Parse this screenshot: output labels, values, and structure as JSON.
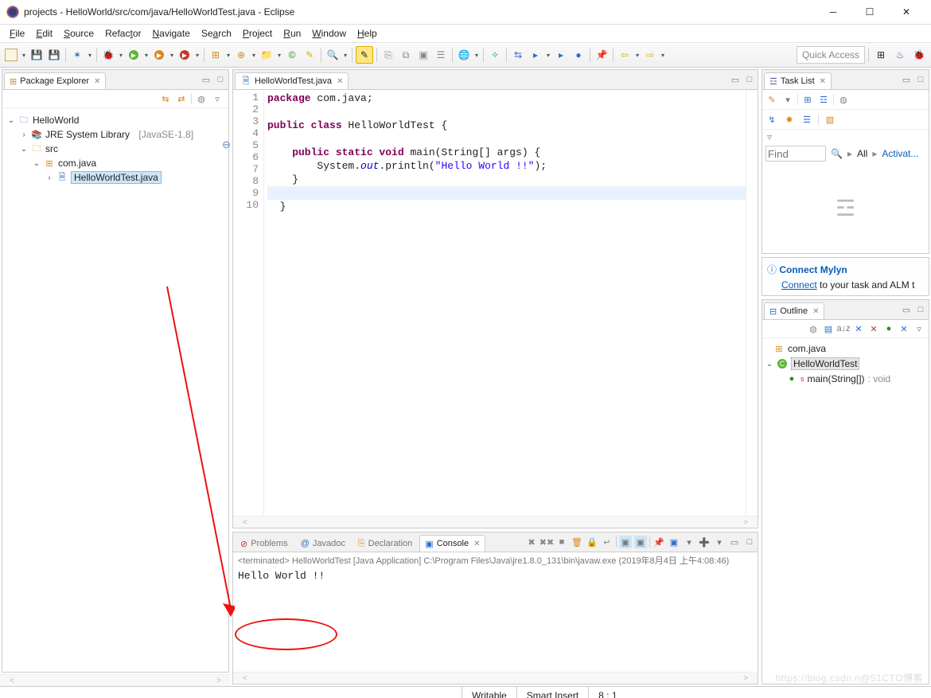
{
  "window": {
    "title": "projects - HelloWorld/src/com/java/HelloWorldTest.java - Eclipse"
  },
  "menu": [
    "File",
    "Edit",
    "Source",
    "Refactor",
    "Navigate",
    "Search",
    "Project",
    "Run",
    "Window",
    "Help"
  ],
  "quick_access_placeholder": "Quick Access",
  "package_explorer": {
    "title": "Package Explorer",
    "project": "HelloWorld",
    "jre": "JRE System Library",
    "jre_suffix": "[JavaSE-1.8]",
    "src": "src",
    "pkg": "com.java",
    "file": "HelloWorldTest.java"
  },
  "editor": {
    "tab": "HelloWorldTest.java",
    "lines": [
      "1",
      "2",
      "3",
      "4",
      "5",
      "6",
      "7",
      "8",
      "9",
      "10"
    ],
    "code": {
      "l1_pre": "package ",
      "l1_pkg": "com.java;",
      "l3_a": "public class ",
      "l3_b": "HelloWorldTest {",
      "l5_a": "    public static void ",
      "l5_b": "main(String[] args) {",
      "l6_a": "        System.",
      "l6_out": "out",
      "l6_b": ".println(",
      "l6_str": "\"Hello World !!\"",
      "l6_c": ");",
      "l7": "    }",
      "l9": "  }"
    }
  },
  "bottom": {
    "tabs": {
      "problems": "Problems",
      "javadoc": "Javadoc",
      "declaration": "Declaration",
      "console": "Console"
    },
    "console_head_a": "<terminated>",
    "console_head_b": " HelloWorldTest [Java Application] C:\\Program Files\\Java\\jre1.8.0_131\\bin\\javaw.exe (2019年8月4日 上午4:08:46)",
    "console_out": "Hello World !!"
  },
  "task_list": {
    "title": "Task List",
    "find_label": "Find",
    "all": "All",
    "activate": "Activat..."
  },
  "mylyn": {
    "header": "Connect Mylyn",
    "link": "Connect",
    "rest": " to your task and ALM t"
  },
  "outline": {
    "title": "Outline",
    "pkg": "com.java",
    "cls": "HelloWorldTest",
    "method": "main(String[])",
    "ret": " : void"
  },
  "status": {
    "writable": "Writable",
    "insert": "Smart Insert",
    "pos": "8 : 1"
  },
  "watermark": "https://blog.csdn.n@51CTO博客"
}
